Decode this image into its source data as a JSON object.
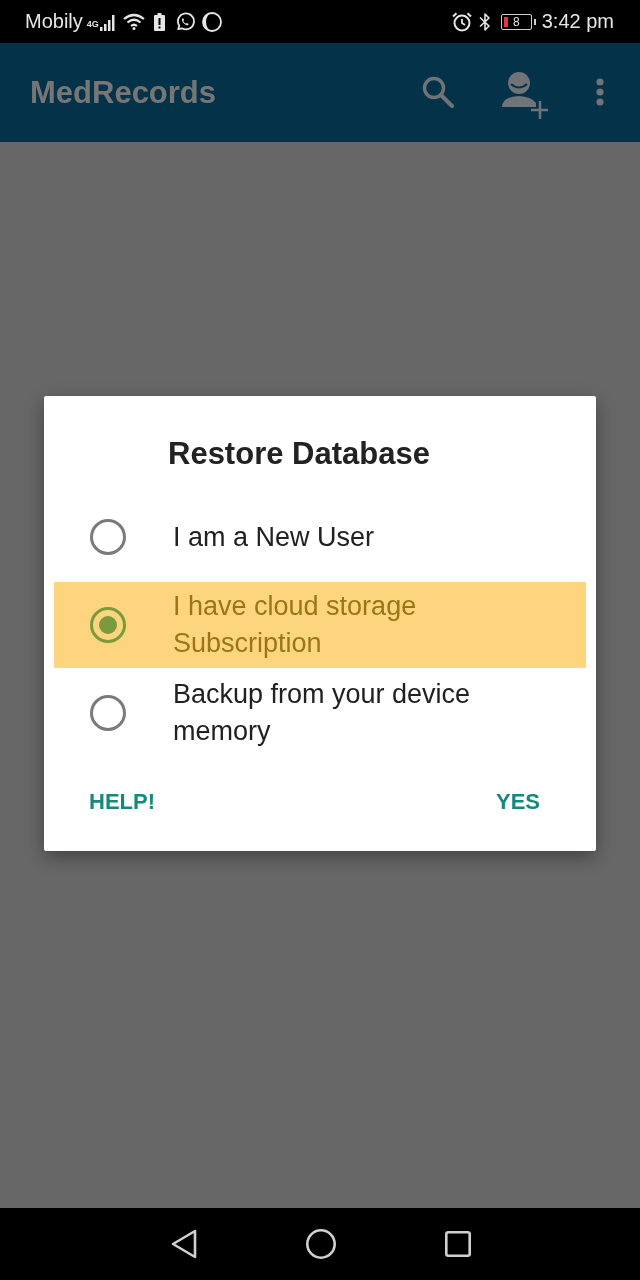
{
  "status_bar": {
    "carrier": "Mobily",
    "network_type": "4G",
    "battery_text": "8",
    "time": "3:42 pm"
  },
  "app_bar": {
    "title": "MedRecords"
  },
  "dialog": {
    "title": "Restore Database",
    "options": [
      {
        "label": "I am a New User",
        "selected": false
      },
      {
        "label": "I have cloud storage Subscription",
        "selected": true
      },
      {
        "label": "Backup from your device memory",
        "selected": false
      }
    ],
    "buttons": [
      {
        "label": "HELP!"
      },
      {
        "label": "YES"
      }
    ]
  }
}
